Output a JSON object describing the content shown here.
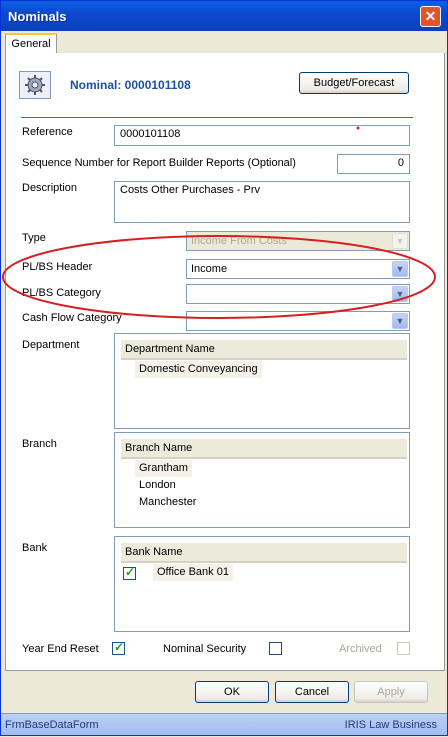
{
  "window": {
    "title": "Nominals",
    "close_glyph": "✕"
  },
  "tabs": [
    {
      "label": "General"
    }
  ],
  "header": {
    "nominal_title": "Nominal: 0000101108",
    "budget_button": "Budget/Forecast"
  },
  "form": {
    "reference_label": "Reference",
    "reference_value": "0000101108",
    "sequence_label": "Sequence Number for Report Builder Reports (Optional)",
    "sequence_value": "0",
    "description_label": "Description",
    "description_value": "Costs Other Purchases - Prv",
    "type_label": "Type",
    "type_value": "Income From Costs",
    "plbs_header_label": "PL/BS Header",
    "plbs_header_value": "Income",
    "plbs_category_label": "PL/BS Category",
    "plbs_category_value": "",
    "cashflow_label": "Cash Flow Category",
    "cashflow_value": ""
  },
  "department": {
    "label": "Department",
    "column": "Department Name",
    "items": [
      "Domestic Conveyancing"
    ]
  },
  "branch": {
    "label": "Branch",
    "column": "Branch Name",
    "items": [
      "Grantham",
      "London",
      "Manchester"
    ]
  },
  "bank": {
    "label": "Bank",
    "column": "Bank Name",
    "items": [
      {
        "name": "Office Bank 01",
        "checked": true
      }
    ]
  },
  "flags": {
    "year_end_reset_label": "Year End Reset",
    "year_end_reset_checked": true,
    "nominal_security_label": "Nominal Security",
    "nominal_security_checked": false,
    "archived_label": "Archived",
    "archived_checked": false
  },
  "buttons": {
    "ok": "OK",
    "cancel": "Cancel",
    "apply": "Apply"
  },
  "status": {
    "left": "FrmBaseDataForm",
    "right": "IRIS Law Business"
  },
  "colors": {
    "title_bar": "#0a5fe4",
    "annotation_oval": "#d42020",
    "nominal_title": "#1f4ea6"
  },
  "icons": [
    "close-icon",
    "gear-icon",
    "dropdown-arrow-icon",
    "checkmark-icon"
  ]
}
